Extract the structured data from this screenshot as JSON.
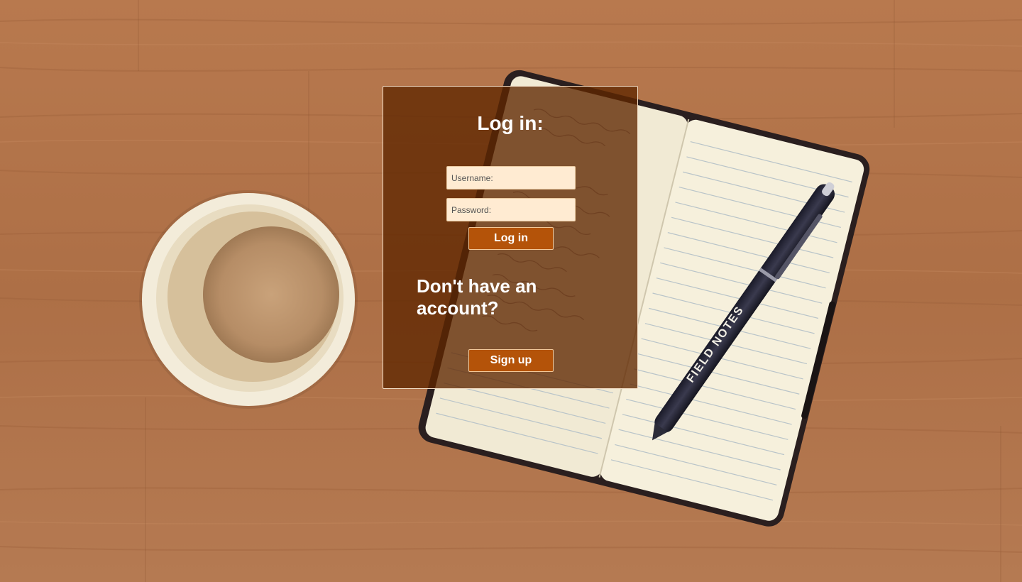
{
  "background": {
    "description_icon": "coffee-cup-and-notebook-photo",
    "pen_brand_text": "FIELD NOTES"
  },
  "login": {
    "title": "Log in:",
    "username_placeholder": "Username:",
    "password_placeholder": "Password:",
    "login_button_label": "Log in"
  },
  "signup": {
    "prompt": "Don't have an account?",
    "signup_button_label": "Sign up"
  },
  "colors": {
    "panel_background": "#5f2600",
    "button_background": "#b45309",
    "input_background": "#ffebd2"
  }
}
